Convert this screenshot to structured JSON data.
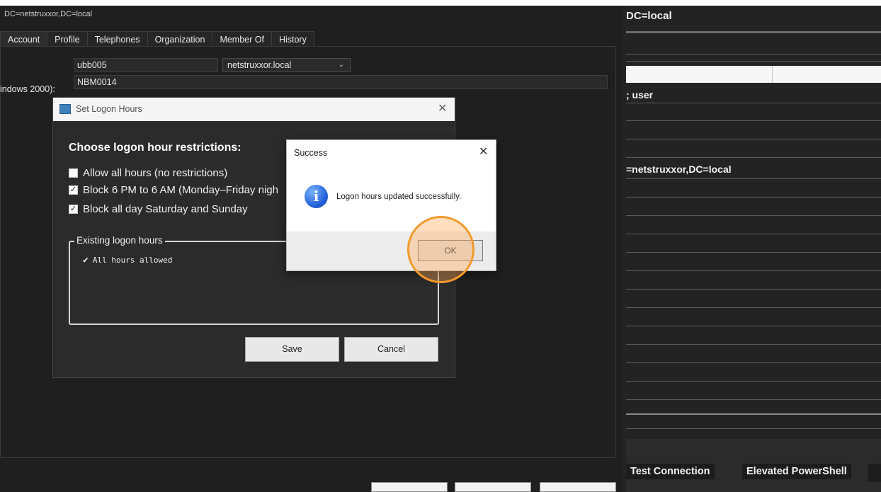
{
  "properties_window": {
    "title": "DC=netstruxxor,DC=local",
    "tabs": [
      {
        "label": "Account",
        "active": true
      },
      {
        "label": "Profile"
      },
      {
        "label": "Telephones"
      },
      {
        "label": "Organization"
      },
      {
        "label": "Member Of"
      },
      {
        "label": "History"
      }
    ],
    "logon_name": "ubb005",
    "domain": "netstruxxor.local",
    "pre2000_label": "indows 2000):",
    "pre2000_name": "NBM0014"
  },
  "right_window": {
    "title": "DC=local",
    "row_user": "; user",
    "row_dn": "=netstruxxor,DC=local",
    "btn_test_connection": "Test Connection",
    "btn_elevated_powershell": "Elevated PowerShell"
  },
  "logon_hours_dialog": {
    "title": "Set Logon Hours",
    "close_glyph": "✕",
    "heading": "Choose logon hour restrictions:",
    "options": [
      {
        "label": "Allow all hours (no restrictions)",
        "checked": false
      },
      {
        "label": "Block 6 PM to 6 AM (Monday–Friday nigh",
        "checked": true
      },
      {
        "label": "Block all day Saturday and Sunday",
        "checked": true
      }
    ],
    "existing_group_label": "Existing logon hours",
    "existing_item": "All hours allowed",
    "save_label": "Save",
    "cancel_label": "Cancel"
  },
  "success_dialog": {
    "title": "Success",
    "close_glyph": "✕",
    "message": "Logon hours updated successfully.",
    "ok_label": "OK",
    "icon": "info-icon"
  },
  "colors": {
    "highlight_ring": "#f39a2b",
    "info_icon": "#1f5fd6",
    "dark_bg": "#1f1f1f"
  }
}
